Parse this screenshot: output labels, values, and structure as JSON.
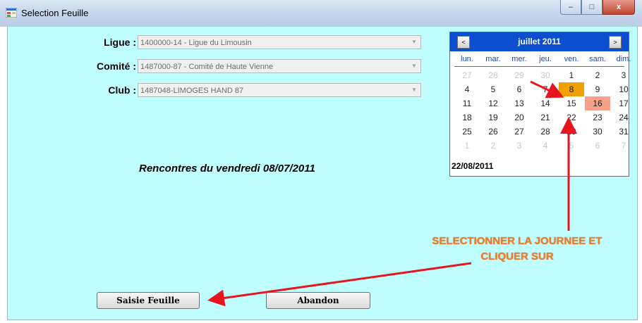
{
  "window": {
    "title": "Selection Feuille",
    "icon": "form-app-icon",
    "controls": {
      "minimize": "–",
      "maximize": "□",
      "close": "x"
    }
  },
  "form": {
    "ligue": {
      "label": "Ligue :",
      "value": "1400000-14 - Ligue du Limousin"
    },
    "comite": {
      "label": "Comité :",
      "value": "1487000-87 - Comité de Haute Vienne"
    },
    "club": {
      "label": "Club :",
      "value": "1487048-LIMOGES HAND 87"
    },
    "dropdown_icon": "chevron-down-icon"
  },
  "rencontres_text": "Rencontres du vendredi  08/07/2011",
  "calendar": {
    "month_label": "juillet 2011",
    "prev": "<",
    "next": ">",
    "days_of_week": [
      "lun.",
      "mar.",
      "mer.",
      "jeu.",
      "ven.",
      "sam.",
      "dim."
    ],
    "weeks": [
      [
        {
          "d": "27",
          "o": true
        },
        {
          "d": "28",
          "o": true
        },
        {
          "d": "29",
          "o": true
        },
        {
          "d": "30",
          "o": true
        },
        {
          "d": "1"
        },
        {
          "d": "2"
        },
        {
          "d": "3"
        }
      ],
      [
        {
          "d": "4"
        },
        {
          "d": "5"
        },
        {
          "d": "6"
        },
        {
          "d": "7"
        },
        {
          "d": "8",
          "sel": true
        },
        {
          "d": "9"
        },
        {
          "d": "10"
        }
      ],
      [
        {
          "d": "11"
        },
        {
          "d": "12"
        },
        {
          "d": "13"
        },
        {
          "d": "14"
        },
        {
          "d": "15"
        },
        {
          "d": "16",
          "today": true
        },
        {
          "d": "17"
        }
      ],
      [
        {
          "d": "18"
        },
        {
          "d": "19"
        },
        {
          "d": "20"
        },
        {
          "d": "21"
        },
        {
          "d": "22"
        },
        {
          "d": "23"
        },
        {
          "d": "24"
        }
      ],
      [
        {
          "d": "25"
        },
        {
          "d": "26"
        },
        {
          "d": "27"
        },
        {
          "d": "28"
        },
        {
          "d": "29"
        },
        {
          "d": "30"
        },
        {
          "d": "31"
        }
      ],
      [
        {
          "d": "1",
          "o": true
        },
        {
          "d": "2",
          "o": true
        },
        {
          "d": "3",
          "o": true
        },
        {
          "d": "4",
          "o": true
        },
        {
          "d": "5",
          "o": true
        },
        {
          "d": "6",
          "o": true
        },
        {
          "d": "7",
          "o": true
        }
      ]
    ],
    "today_footer": "22/08/2011",
    "selected_color": "#f0a000",
    "today_color": "#f6a28a"
  },
  "buttons": {
    "saisie": "Saisie Feuille",
    "abandon": "Abandon"
  },
  "annotation": {
    "line1": "SELECTIONNER LA JOURNEE ET",
    "line2": "CLIQUER SUR",
    "color": "#f07b2a",
    "arrow_color": "#e8141e"
  }
}
